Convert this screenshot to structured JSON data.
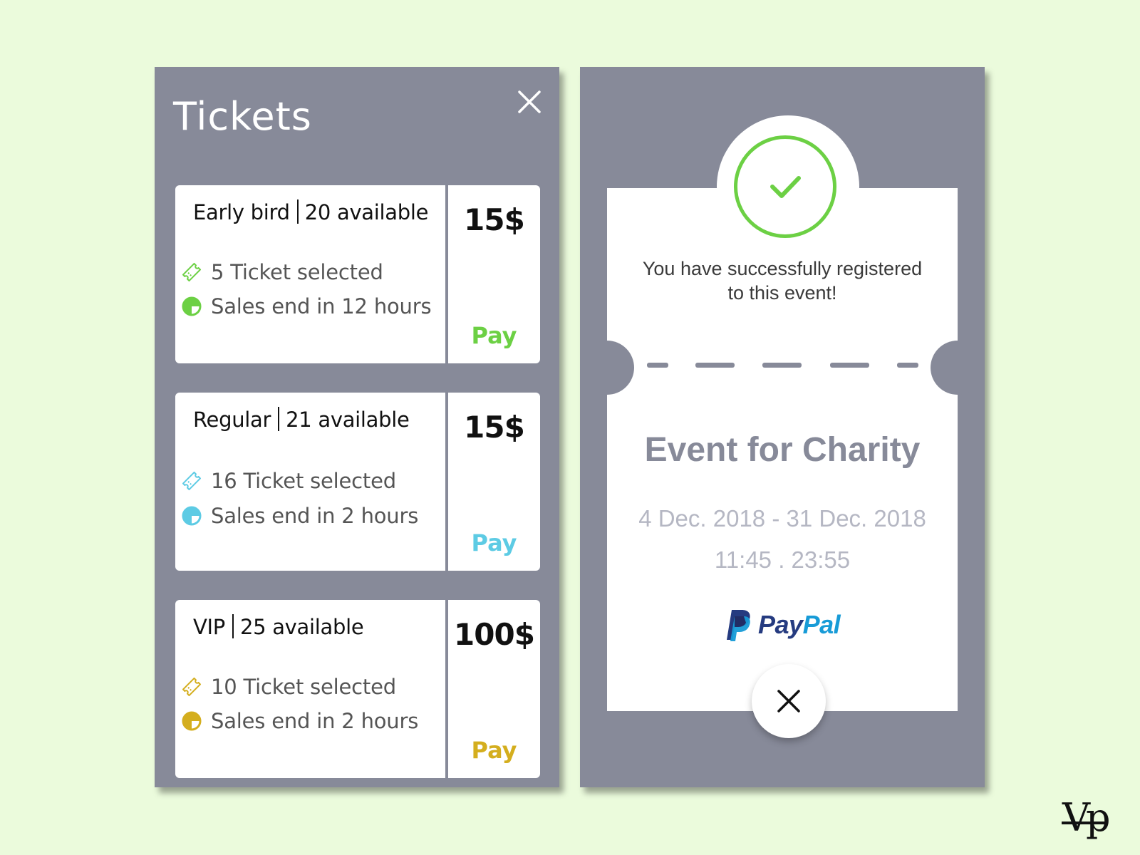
{
  "tickets_panel": {
    "title": "Tickets",
    "close_icon": "close-icon",
    "tickets": [
      {
        "name": "Early bird",
        "availability": "20 available",
        "selected": "5 Ticket selected",
        "sales_end": "Sales end in 12 hours",
        "price": "15$",
        "pay_label": "Pay",
        "accent": "#6cd044"
      },
      {
        "name": "Regular",
        "availability": "21 available",
        "selected": "16 Ticket selected",
        "sales_end": "Sales end in 2 hours",
        "price": "15$",
        "pay_label": "Pay",
        "accent": "#5dcbe4"
      },
      {
        "name": "VIP",
        "availability": "25 available",
        "selected": "10 Ticket selected",
        "sales_end": "Sales end in 2 hours",
        "price": "100$",
        "pay_label": "Pay",
        "accent": "#d4ae1e"
      }
    ]
  },
  "success_panel": {
    "check_icon": "check-icon",
    "message_line1": "You have successfully registered",
    "message_line2": "to this event!",
    "event_title": "Event for Charity",
    "event_dates": "4 Dec. 2018 - 31 Dec. 2018",
    "event_times": "11:45 . 23:55",
    "payment_logo": {
      "icon": "paypal-logo-icon",
      "word_pay": "Pay",
      "word_pal": "Pal"
    },
    "close_icon": "close-icon"
  },
  "watermark": "Vp",
  "colors": {
    "background": "#ebfbdc",
    "panel": "#878a99",
    "success_green": "#6cd044",
    "paypal_dark": "#253b80",
    "paypal_light": "#179bd7"
  }
}
